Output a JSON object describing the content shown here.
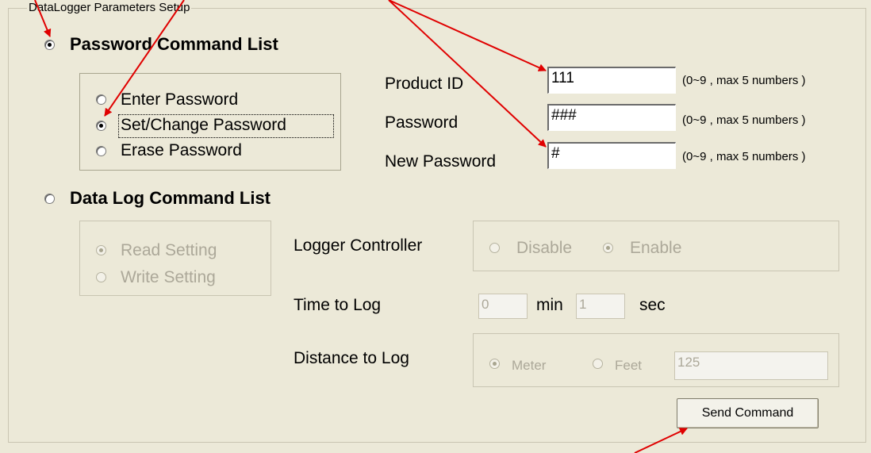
{
  "group_title": "DataLogger Parameters Setup",
  "password_section": {
    "title": "Password Command List",
    "options": [
      "Enter Password",
      "Set/Change Password",
      "Erase Password"
    ],
    "selected": "Set/Change Password",
    "fields": [
      {
        "label": "Product ID",
        "value": "111",
        "hint": "(0~9 , max 5 numbers )"
      },
      {
        "label": "Password",
        "value": "###",
        "hint": "(0~9 , max 5 numbers )"
      },
      {
        "label": "New Password",
        "value": "#",
        "hint": "(0~9 , max 5 numbers )"
      }
    ]
  },
  "datalog_section": {
    "title": "Data Log Command List",
    "options": [
      "Read Setting",
      "Write Setting"
    ],
    "selected": "Read Setting",
    "logger_controller": {
      "label": "Logger Controller",
      "options": [
        "Disable",
        "Enable"
      ],
      "selected": "Enable"
    },
    "time_to_log": {
      "label": "Time to Log",
      "min_value": "0",
      "min_unit": "min",
      "sec_value": "1",
      "sec_unit": "sec"
    },
    "distance_to_log": {
      "label": "Distance to Log",
      "options": [
        "Meter",
        "Feet"
      ],
      "selected": "Meter",
      "value": "125"
    }
  },
  "send_button": "Send Command",
  "annotation_color": "#e00000"
}
